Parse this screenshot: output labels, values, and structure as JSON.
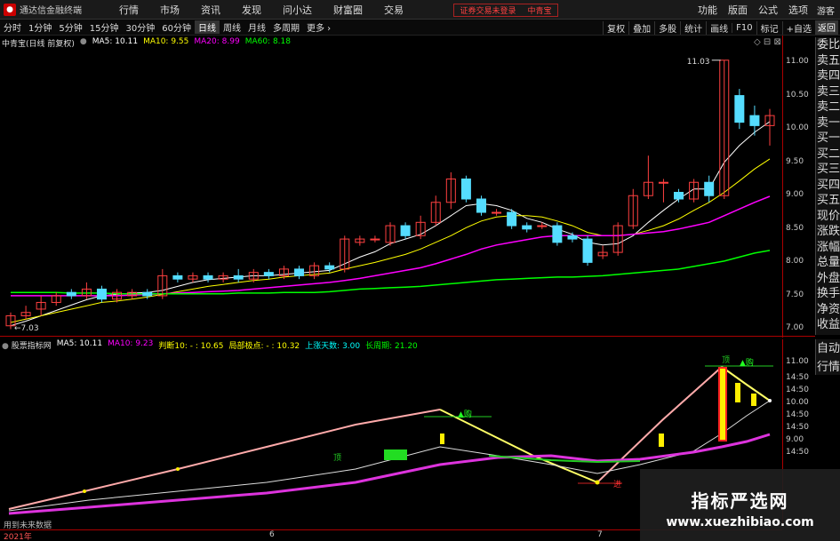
{
  "titlebar": {
    "app_title": "通达信金融终端",
    "menus": [
      "行情",
      "市场",
      "资讯",
      "发现",
      "问小达",
      "财富圈",
      "交易"
    ],
    "notice_text": "证券交易未登录",
    "notice_stock": "中青宝",
    "right_menus": [
      "功能",
      "版面",
      "公式",
      "选项"
    ],
    "guest": "游客"
  },
  "toolbar": {
    "periods": [
      "分时",
      "1分钟",
      "5分钟",
      "15分钟",
      "30分钟",
      "60分钟",
      "日线",
      "周线",
      "月线",
      "多周期",
      "更多"
    ],
    "active_period": "日线",
    "buttons": [
      "复权",
      "叠加",
      "多股",
      "统计",
      "画线",
      "F10",
      "标记",
      "+自选"
    ],
    "back": "返回"
  },
  "main_chart": {
    "stock_title": "中青宝(日线 前复权)",
    "ma5": "MA5: 10.11",
    "ma10": "MA10: 9.55",
    "ma20": "MA20: 8.99",
    "ma60": "MA60: 8.18",
    "high_label": "11.03",
    "low_label": "7.03",
    "price_ticks": [
      "11.00",
      "10.50",
      "10.00",
      "9.50",
      "9.00",
      "8.50",
      "8.00",
      "7.50",
      "7.00"
    ]
  },
  "side_panel": {
    "items": [
      "委比",
      "卖五",
      "卖四",
      "卖三",
      "卖二",
      "卖一",
      "买一",
      "买二",
      "买三",
      "买四",
      "买五",
      "现价",
      "涨跌",
      "涨幅",
      "总量",
      "外盘",
      "换手",
      "净资",
      "收益"
    ],
    "sub_items": [
      "自动",
      "行情"
    ]
  },
  "sub_chart": {
    "name": "股票指标网",
    "ma5": "MA5: 10.11",
    "ma10": "MA10: 9.23",
    "judge": "判断10: - : 10.65",
    "local_point": "局部极点: - : 10.32",
    "up_days": "上涨天数: 3.00",
    "cycle": "长周期: 21.20",
    "labels": {
      "top1": "顶",
      "top2": "顶",
      "buy1": "▲购",
      "buy2": "▲购",
      "low": "进",
      "mid": "顶"
    },
    "ticks": [
      "11.00",
      "14:50",
      "14:50",
      "10.00",
      "14:50",
      "14:50",
      "9.00",
      "14:50"
    ],
    "future_note": "用到未来数据"
  },
  "bottom_axis": {
    "dates": [
      "2021年",
      "6",
      "7"
    ]
  },
  "watermark": {
    "title": "指标严选网",
    "url": "www.xuezhibiao.com"
  },
  "chart_data": {
    "type": "candlestick",
    "ma_series": [
      {
        "name": "MA5",
        "color": "#ffffff"
      },
      {
        "name": "MA10",
        "color": "#ffff00"
      },
      {
        "name": "MA20",
        "color": "#ff00ff"
      },
      {
        "name": "MA60",
        "color": "#00ff00"
      }
    ],
    "ylim": [
      6.9,
      11.2
    ],
    "candles": [
      [
        7.05,
        7.2,
        7.0,
        7.25
      ],
      [
        7.2,
        7.25,
        7.15,
        7.35
      ],
      [
        7.3,
        7.4,
        7.2,
        7.5
      ],
      [
        7.4,
        7.5,
        7.35,
        7.55
      ],
      [
        7.55,
        7.5,
        7.45,
        7.6
      ],
      [
        7.5,
        7.6,
        7.45,
        7.7
      ],
      [
        7.6,
        7.45,
        7.4,
        7.65
      ],
      [
        7.45,
        7.55,
        7.4,
        7.6
      ],
      [
        7.5,
        7.55,
        7.45,
        7.6
      ],
      [
        7.55,
        7.5,
        7.45,
        7.6
      ],
      [
        7.5,
        7.8,
        7.45,
        7.9
      ],
      [
        7.8,
        7.75,
        7.7,
        7.85
      ],
      [
        7.75,
        7.8,
        7.7,
        7.85
      ],
      [
        7.8,
        7.75,
        7.7,
        7.85
      ],
      [
        7.75,
        7.8,
        7.7,
        7.85
      ],
      [
        7.8,
        7.75,
        7.7,
        7.9
      ],
      [
        7.75,
        7.85,
        7.7,
        7.9
      ],
      [
        7.85,
        7.8,
        7.75,
        7.9
      ],
      [
        7.8,
        7.9,
        7.75,
        7.95
      ],
      [
        7.9,
        7.8,
        7.75,
        7.95
      ],
      [
        7.8,
        7.95,
        7.75,
        8.0
      ],
      [
        7.95,
        7.9,
        7.85,
        8.0
      ],
      [
        7.9,
        8.35,
        7.85,
        8.4
      ],
      [
        8.3,
        8.35,
        8.25,
        8.4
      ],
      [
        8.35,
        8.35,
        8.3,
        8.4
      ],
      [
        8.3,
        8.55,
        8.25,
        8.6
      ],
      [
        8.55,
        8.4,
        8.35,
        8.6
      ],
      [
        8.4,
        8.6,
        8.35,
        8.7
      ],
      [
        8.6,
        8.9,
        8.55,
        9.0
      ],
      [
        8.9,
        9.25,
        8.8,
        9.35
      ],
      [
        9.25,
        8.95,
        8.9,
        9.3
      ],
      [
        8.95,
        8.75,
        8.7,
        9.0
      ],
      [
        8.75,
        8.75,
        8.7,
        8.8
      ],
      [
        8.75,
        8.55,
        8.5,
        8.8
      ],
      [
        8.55,
        8.5,
        8.45,
        8.6
      ],
      [
        8.55,
        8.55,
        8.5,
        8.6
      ],
      [
        8.55,
        8.3,
        8.25,
        8.6
      ],
      [
        8.4,
        8.35,
        8.3,
        8.45
      ],
      [
        8.35,
        8.0,
        7.95,
        8.4
      ],
      [
        8.1,
        8.15,
        8.05,
        8.25
      ],
      [
        8.15,
        8.55,
        8.1,
        8.6
      ],
      [
        8.55,
        9.0,
        8.5,
        9.1
      ],
      [
        9.0,
        9.2,
        8.95,
        9.6
      ],
      [
        9.2,
        9.2,
        8.9,
        9.25
      ],
      [
        9.05,
        8.95,
        8.9,
        9.1
      ],
      [
        8.95,
        9.2,
        8.9,
        9.25
      ],
      [
        9.2,
        9.0,
        8.9,
        9.3
      ],
      [
        9.0,
        11.03,
        8.95,
        11.03
      ],
      [
        10.5,
        10.1,
        10.0,
        10.6
      ],
      [
        10.2,
        10.05,
        9.9,
        10.35
      ],
      [
        10.05,
        10.2,
        9.75,
        10.3
      ]
    ],
    "ma_values": {
      "MA5": [
        7.05,
        7.12,
        7.2,
        7.28,
        7.36,
        7.44,
        7.5,
        7.52,
        7.54,
        7.55,
        7.58,
        7.64,
        7.7,
        7.74,
        7.76,
        7.78,
        7.8,
        7.8,
        7.82,
        7.84,
        7.86,
        7.88,
        7.98,
        8.08,
        8.16,
        8.28,
        8.35,
        8.42,
        8.55,
        8.7,
        8.85,
        8.88,
        8.85,
        8.78,
        8.66,
        8.6,
        8.5,
        8.42,
        8.3,
        8.26,
        8.28,
        8.4,
        8.6,
        8.78,
        8.95,
        9.1,
        9.1,
        9.5,
        9.75,
        9.95,
        10.11
      ],
      "MA10": [
        7.1,
        7.15,
        7.2,
        7.25,
        7.3,
        7.35,
        7.4,
        7.42,
        7.45,
        7.48,
        7.52,
        7.56,
        7.6,
        7.64,
        7.67,
        7.7,
        7.73,
        7.75,
        7.78,
        7.8,
        7.82,
        7.84,
        7.9,
        7.95,
        8.0,
        8.06,
        8.12,
        8.2,
        8.3,
        8.4,
        8.52,
        8.62,
        8.68,
        8.7,
        8.7,
        8.68,
        8.62,
        8.55,
        8.45,
        8.4,
        8.4,
        8.42,
        8.48,
        8.55,
        8.65,
        8.78,
        8.9,
        9.05,
        9.22,
        9.4,
        9.55
      ],
      "MA20": [
        7.5,
        7.5,
        7.5,
        7.5,
        7.5,
        7.5,
        7.5,
        7.5,
        7.51,
        7.52,
        7.53,
        7.54,
        7.55,
        7.56,
        7.57,
        7.58,
        7.6,
        7.62,
        7.64,
        7.66,
        7.68,
        7.7,
        7.73,
        7.76,
        7.8,
        7.84,
        7.88,
        7.92,
        7.98,
        8.05,
        8.12,
        8.2,
        8.26,
        8.3,
        8.34,
        8.38,
        8.4,
        8.4,
        8.4,
        8.4,
        8.4,
        8.42,
        8.44,
        8.46,
        8.5,
        8.55,
        8.6,
        8.7,
        8.8,
        8.9,
        8.99
      ],
      "MA60": [
        7.55,
        7.55,
        7.55,
        7.55,
        7.54,
        7.54,
        7.54,
        7.53,
        7.53,
        7.53,
        7.53,
        7.53,
        7.53,
        7.53,
        7.53,
        7.54,
        7.54,
        7.54,
        7.55,
        7.55,
        7.55,
        7.56,
        7.58,
        7.6,
        7.61,
        7.62,
        7.63,
        7.64,
        7.66,
        7.68,
        7.7,
        7.72,
        7.74,
        7.75,
        7.76,
        7.77,
        7.78,
        7.78,
        7.79,
        7.8,
        7.82,
        7.84,
        7.86,
        7.88,
        7.9,
        7.94,
        7.98,
        8.02,
        8.08,
        8.14,
        8.18
      ]
    }
  }
}
